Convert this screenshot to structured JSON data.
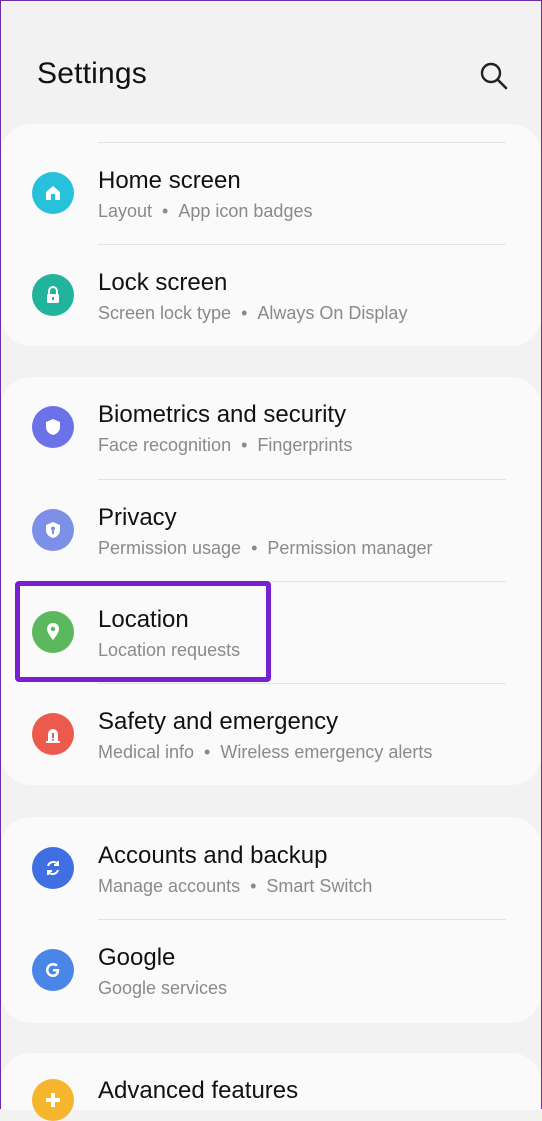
{
  "header": {
    "title": "Settings",
    "search_icon": "search-icon"
  },
  "colors": {
    "home": "#28c1dc",
    "lock": "#22b39c",
    "biometrics": "#6b72e8",
    "privacy": "#7b90e6",
    "location": "#5cb85c",
    "safety": "#ec5a4e",
    "accounts": "#3f6fe0",
    "google": "#4a86e8",
    "advanced": "#f5b62d",
    "highlight": "#7a1fd0"
  },
  "items": {
    "home": {
      "label": "Home screen",
      "sub1": "Layout",
      "sub2": "App icon badges"
    },
    "lock": {
      "label": "Lock screen",
      "sub1": "Screen lock type",
      "sub2": "Always On Display"
    },
    "biometrics": {
      "label": "Biometrics and security",
      "sub1": "Face recognition",
      "sub2": "Fingerprints"
    },
    "privacy": {
      "label": "Privacy",
      "sub1": "Permission usage",
      "sub2": "Permission manager"
    },
    "location": {
      "label": "Location",
      "sub1": "Location requests"
    },
    "safety": {
      "label": "Safety and emergency",
      "sub1": "Medical info",
      "sub2": "Wireless emergency alerts"
    },
    "accounts": {
      "label": "Accounts and backup",
      "sub1": "Manage accounts",
      "sub2": "Smart Switch"
    },
    "google": {
      "label": "Google",
      "sub1": "Google services"
    },
    "advanced": {
      "label": "Advanced features"
    }
  },
  "separator": "•"
}
